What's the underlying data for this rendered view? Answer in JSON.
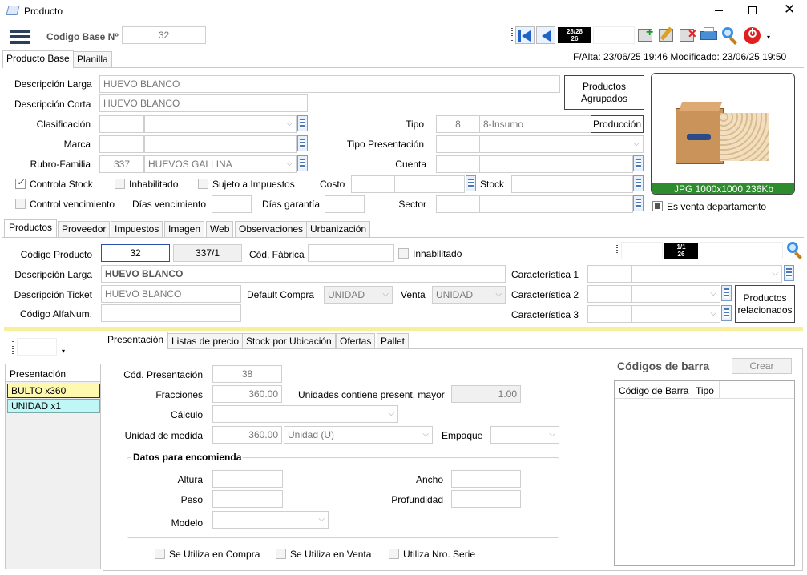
{
  "window": {
    "title": "Producto"
  },
  "header": {
    "codigo_base_label": "Codigo Base Nº",
    "codigo_base_value": "32",
    "record_counter": "28/28\n26",
    "falta_text": "F/Alta: 23/06/25 19:46 Modificado: 23/06/25 19:50"
  },
  "top_tabs": [
    "Producto Base",
    "Planilla"
  ],
  "base": {
    "desc_larga_label": "Descripción Larga",
    "desc_larga_value": "HUEVO BLANCO",
    "desc_corta_label": "Descripción Corta",
    "desc_corta_value": "HUEVO BLANCO",
    "clasificacion_label": "Clasificación",
    "marca_label": "Marca",
    "rubro_label": "Rubro-Familia",
    "rubro_code": "337",
    "rubro_name": "HUEVOS GALLINA",
    "tipo_label": "Tipo",
    "tipo_code": "8",
    "tipo_name": "8-Insumo",
    "produccion_label": "Producción",
    "tipo_presentacion_label": "Tipo Presentación",
    "cuenta_label": "Cuenta",
    "costo_label": "Costo",
    "stock_label": "Stock",
    "sector_label": "Sector",
    "productos_agrupados_label": "Productos Agrupados",
    "image_caption": "JPG 1000x1000 236Kb",
    "controla_stock": "Controla Stock",
    "inhabilitado": "Inhabilitado",
    "sujeto_impuestos": "Sujeto a Impuestos",
    "control_vencimiento": "Control vencimiento",
    "dias_vencimiento": "Días vencimiento",
    "dias_garantia": "Días garantía",
    "es_venta_departamento": "Es venta departamento"
  },
  "mid_tabs": [
    "Productos",
    "Proveedor",
    "Impuestos",
    "Imagen",
    "Web",
    "Observaciones",
    "Urbanización"
  ],
  "producto": {
    "codigo_label": "Código Producto",
    "codigo_value": "32",
    "codigo2_value": "337/1",
    "cod_fabrica_label": "Cód. Fábrica",
    "inhabilitado": "Inhabilitado",
    "desc_larga_label": "Descripción Larga",
    "desc_larga_value": "HUEVO BLANCO",
    "desc_ticket_label": "Descripción Ticket",
    "desc_ticket_value": "HUEVO BLANCO",
    "default_compra_label": "Default Compra",
    "default_compra_value": "UNIDAD",
    "venta_label": "Venta",
    "venta_value": "UNIDAD",
    "codigo_alfanum_label": "Código AlfaNum.",
    "car1_label": "Característica 1",
    "car2_label": "Característica 2",
    "car3_label": "Característica 3",
    "productos_relacionados_label": "Productos relacionados",
    "counter": "1/1\n26"
  },
  "presentaciones": {
    "header": "Presentación",
    "items": [
      "BULTO x360",
      "UNIDAD x1"
    ]
  },
  "bottom_tabs": [
    "Presentación",
    "Listas de precio",
    "Stock por Ubicación",
    "Ofertas",
    "Pallet"
  ],
  "presentacion": {
    "cod_label": "Cód. Presentación",
    "cod_value": "38",
    "fracciones_label": "Fracciones",
    "fracciones_value": "360.00",
    "unidades_mayor_label": "Unidades contiene present. mayor",
    "unidades_mayor_value": "1.00",
    "calculo_label": "Cálculo",
    "unidad_medida_label": "Unidad de medida",
    "unidad_medida_value": "360.00",
    "unidad_medida_select": "Unidad (U)",
    "empaque_label": "Empaque",
    "encomienda_title": "Datos para encomienda",
    "altura_label": "Altura",
    "ancho_label": "Ancho",
    "peso_label": "Peso",
    "profundidad_label": "Profundidad",
    "modelo_label": "Modelo",
    "usa_compra": "Se Utiliza en Compra",
    "usa_venta": "Se Utiliza en Venta",
    "nro_serie": "Utiliza Nro. Serie"
  },
  "barcodes": {
    "title": "Códigos de barra",
    "crear_label": "Crear",
    "col_codigo": "Código de Barra",
    "col_tipo": "Tipo"
  }
}
